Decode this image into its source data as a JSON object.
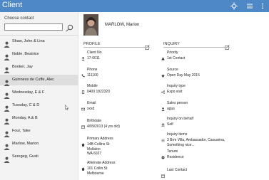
{
  "app": {
    "title": "Client"
  },
  "sidebar": {
    "heading": "Choose contact",
    "search": {
      "value": "",
      "placeholder": ""
    },
    "contacts": [
      {
        "name": "Shaw, John & Lina"
      },
      {
        "name": "Noble, Beatrice"
      },
      {
        "name": "Booker, Jay"
      },
      {
        "name": "Guinness de Cuffe, Alec",
        "selected": true
      },
      {
        "name": "Wednesday, E & F"
      },
      {
        "name": "Tuesday, C & D"
      },
      {
        "name": "Monday, A & B"
      },
      {
        "name": "Four, Take"
      },
      {
        "name": "Marlow, Marion"
      },
      {
        "name": "Seregeg, Gusti"
      }
    ]
  },
  "contact": {
    "name": "MARLOW, Marion"
  },
  "profile": {
    "title": "PROFILE",
    "fields": [
      {
        "icon": "person-icon",
        "label": "Client No",
        "value": "17-0011"
      },
      {
        "icon": "phone-icon",
        "label": "Phone",
        "value": "111100"
      },
      {
        "icon": "mobile-icon",
        "label": "Mobile",
        "value": "0400 1822320"
      },
      {
        "icon": "email-icon",
        "label": "Email",
        "value": "xxxd"
      },
      {
        "icon": "calendar-icon",
        "label": "Birthdate",
        "value": "4/09/2013 (4 yrs old)"
      },
      {
        "icon": "home-icon",
        "label": "Primary Address",
        "value": "14B Collins St\nMullaloo\nWA 6027"
      },
      {
        "icon": "home-icon",
        "label": "Alternate Address",
        "value": "101 Collin St\nMelbourne"
      }
    ]
  },
  "inquiry": {
    "title": "INQUIRY",
    "fields": [
      {
        "icon": "priority-icon",
        "label": "Priority",
        "value": "1st Contact"
      },
      {
        "icon": "star-icon",
        "label": "Source",
        "value": "Open Day May 2015"
      },
      {
        "icon": "share-icon",
        "label": "Inquiry type",
        "value": "Expo visit"
      },
      {
        "icon": "person-icon",
        "label": "Sales person",
        "value": "agus"
      },
      {
        "icon": "people-icon",
        "label": "Inquiry on behalf",
        "value": "Self"
      },
      {
        "icon": "list-icon",
        "label": "Inquiry items",
        "value": "3 Brm Villa, Ambassador, Casuarina,\nSomething nice..."
      },
      {
        "icon": "tenure-icon",
        "label": "Tenure",
        "value": "Residence"
      },
      {
        "icon": "calendar-icon",
        "label": "Last Contact",
        "value": ""
      }
    ]
  }
}
